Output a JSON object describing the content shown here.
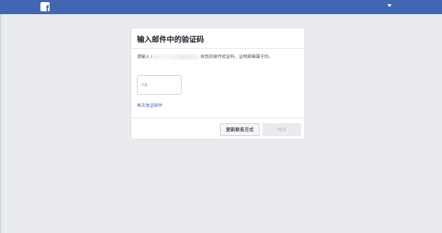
{
  "header": {
    "logo_letter": "f",
    "logo_icon": "facebook-logo-icon",
    "menu_icon": "caret-down-icon",
    "brand_color": "#4267b2"
  },
  "dialog": {
    "title": "输入邮件中的验证码",
    "description_prefix": "请输入 I",
    "description_suffix": " 收到的邮件验证码，证明邮箱属于你。",
    "code_input": {
      "value": "",
      "placeholder": "FB-"
    },
    "resend_link": "再次发送邮件",
    "change_contact_button": "更新联系方式",
    "continue_button": "继续"
  }
}
